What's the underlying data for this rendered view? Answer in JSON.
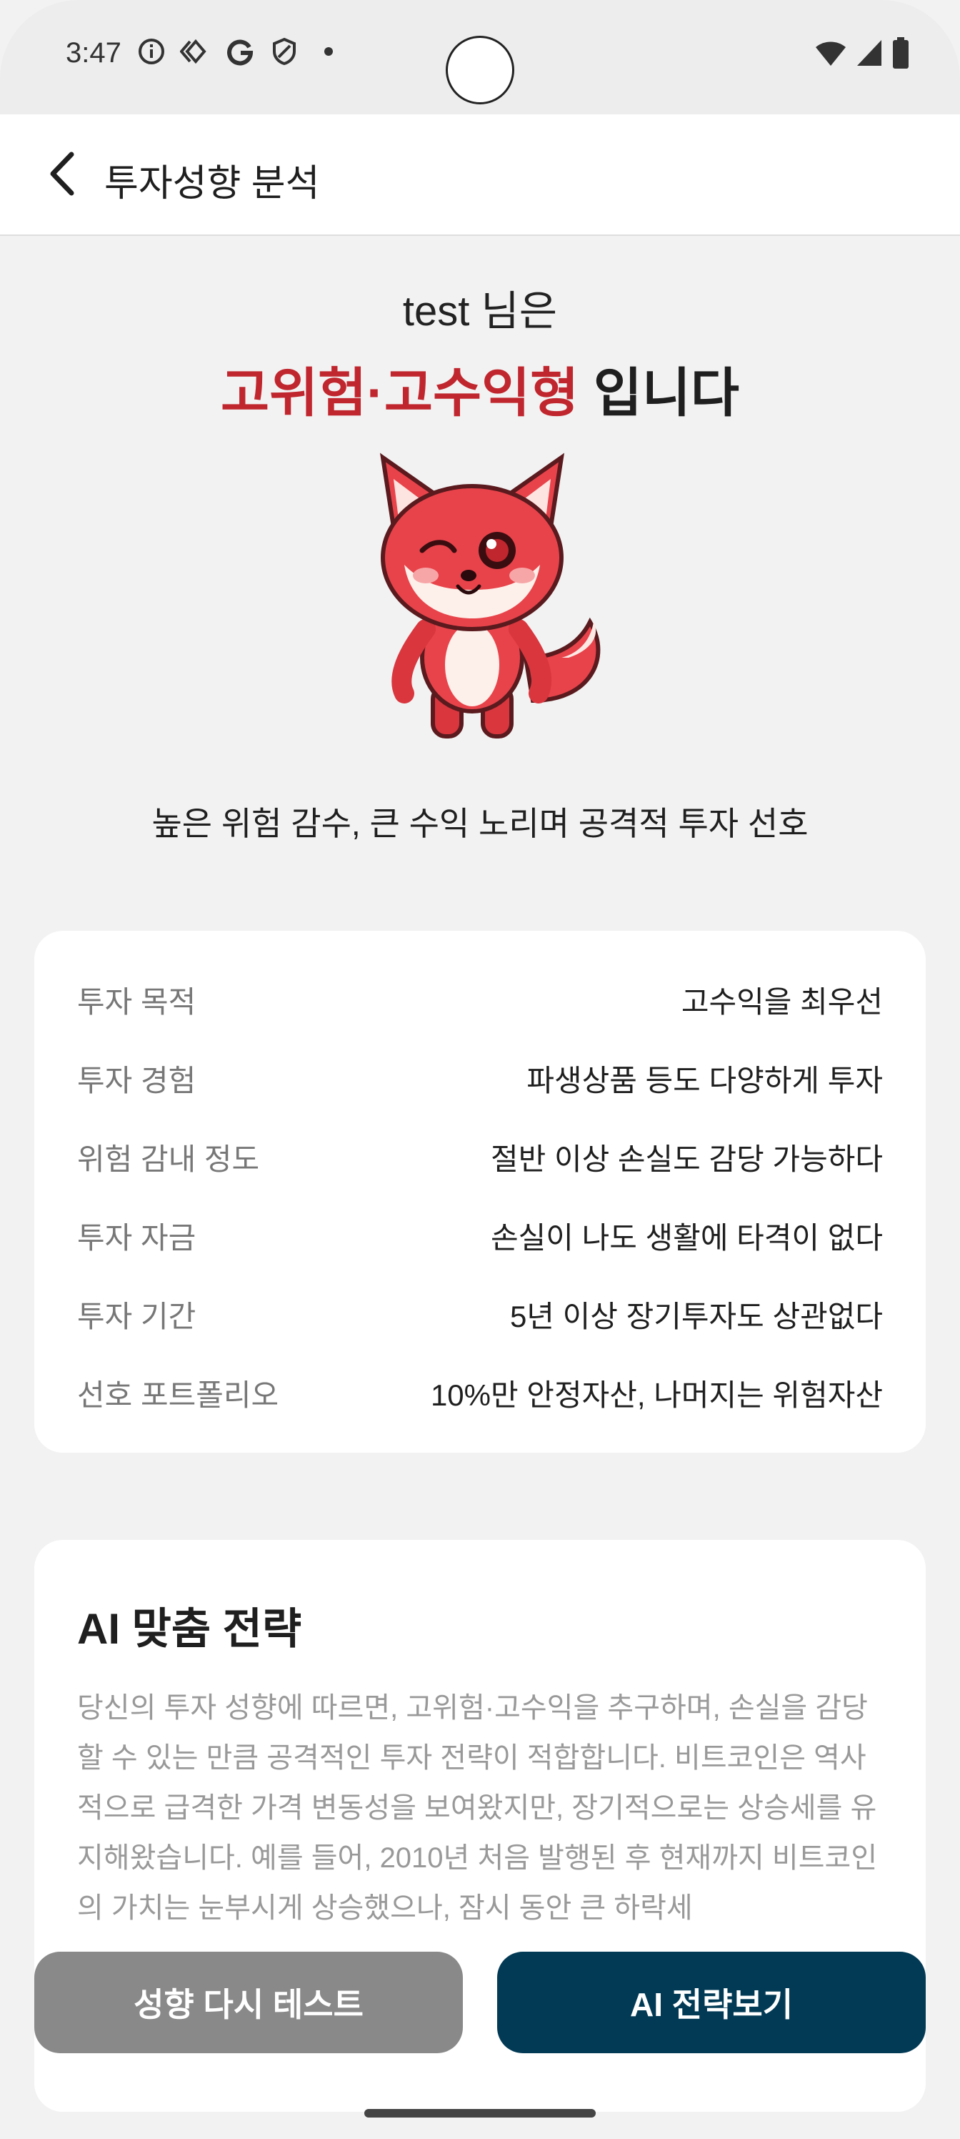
{
  "status_bar": {
    "time": "3:47",
    "left_icons": [
      "info-icon",
      "diamond-icon",
      "google-icon",
      "shield-icon",
      "dot-icon"
    ],
    "right_icons": [
      "wifi-icon",
      "signal-icon",
      "battery-icon"
    ]
  },
  "app_bar": {
    "back_icon": "chevron-left-icon",
    "title": "투자성향 분석"
  },
  "result": {
    "user_line": "test 님은",
    "type_name": "고위험·고수익형",
    "type_suffix": " 입니다",
    "mascot": "red-fox-mascot",
    "summary": "높은 위험 감수, 큰 수익 노리며 공격적 투자 선호"
  },
  "profile": {
    "rows": [
      {
        "key": "투자 목적",
        "value": "고수익을 최우선"
      },
      {
        "key": "투자 경험",
        "value": "파생상품 등도 다양하게 투자"
      },
      {
        "key": "위험 감내 정도",
        "value": "절반 이상 손실도 감당 가능하다"
      },
      {
        "key": "투자 자금",
        "value": "손실이 나도 생활에 타격이 없다"
      },
      {
        "key": "투자 기간",
        "value": "5년 이상 장기투자도 상관없다"
      },
      {
        "key": "선호 포트폴리오",
        "value": "10%만 안정자산, 나머지는 위험자산"
      }
    ]
  },
  "strategy": {
    "title": "AI 맞춤 전략",
    "body": "당신의 투자 성향에 따르면, 고위험·고수익을 추구하며, 손실을 감당할 수 있는 만큼 공격적인 투자 전략이 적합합니다. 비트코인은 역사적으로 급격한 가격 변동성을 보여왔지만, 장기적으로는 상승세를 유지해왔습니다. 예를 들어, 2010년 처음 발행된 후 현재까지 비트코인의 가치는 눈부시게 상승했으나, 잠시 동안 큰 하락세"
  },
  "buttons": {
    "retest": "성향 다시 테스트",
    "ai_strategy": "AI 전략보기"
  },
  "colors": {
    "accent_red": "#c0262d",
    "primary_navy": "#023a55",
    "secondary_gray": "#898989"
  }
}
